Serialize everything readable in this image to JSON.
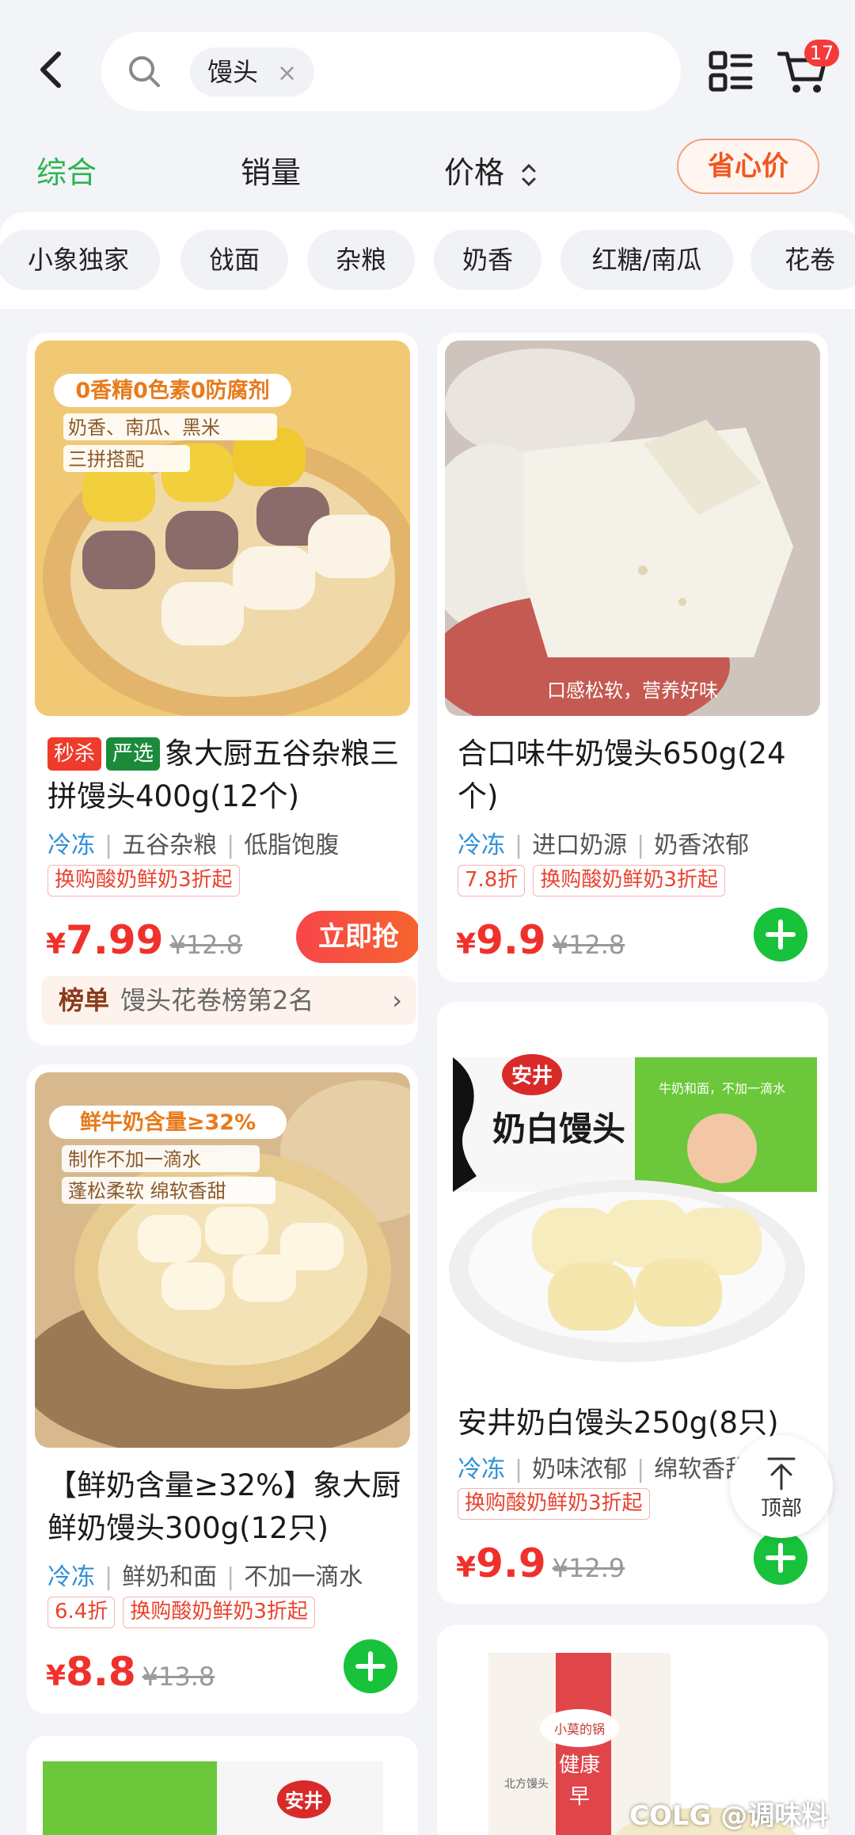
{
  "header": {
    "search_chip": "馒头",
    "search_chip_close": "×",
    "cart_count": "17"
  },
  "sort_tabs": [
    {
      "label": "综合",
      "active": true
    },
    {
      "label": "销量"
    },
    {
      "label": "价格"
    }
  ],
  "value_button": "省心价",
  "filters": [
    "小象独家",
    "戗面",
    "杂粮",
    "奶香",
    "红糖/南瓜",
    "花卷"
  ],
  "products": [
    {
      "badges": [
        "秒杀",
        "严选"
      ],
      "title": "象大厨五谷杂粮三拼馒头400g(12个)",
      "tags": [
        "冷冻",
        "五谷杂粮",
        "低脂饱腹"
      ],
      "promos": [
        "换购酸奶鲜奶3折起"
      ],
      "price_symbol": "¥",
      "price": "7.99",
      "old_price": "¥12.8",
      "buy_label": "立即抢",
      "rank_label": "榜单",
      "rank_text": "馒头花卷榜第2名",
      "image_texts": [
        "0香精0色素0防腐剂",
        "奶香、南瓜、黑米",
        "三拼搭配"
      ]
    },
    {
      "title": "合口味牛奶馒头650g(24个)",
      "tags": [
        "冷冻",
        "进口奶源",
        "奶香浓郁"
      ],
      "promos": [
        "7.8折",
        "换购酸奶鲜奶3折起"
      ],
      "price_symbol": "¥",
      "price": "9.9",
      "old_price": "¥12.8",
      "image_texts": [
        "口感松软，营养好味"
      ]
    },
    {
      "title": "【鲜奶含量≥32%】象大厨鲜奶馒头300g(12只)",
      "tags": [
        "冷冻",
        "鲜奶和面",
        "不加一滴水"
      ],
      "promos": [
        "6.4折",
        "换购酸奶鲜奶3折起"
      ],
      "price_symbol": "¥",
      "price": "8.8",
      "old_price": "¥13.8",
      "image_texts": [
        "鲜牛奶含量≥32%",
        "制作不加一滴水",
        "蓬松柔软 绵软香甜"
      ]
    },
    {
      "title": "安井奶白馒头250g(8只)",
      "tags": [
        "冷冻",
        "奶味浓郁",
        "绵软香甜"
      ],
      "promos": [
        "换购酸奶鲜奶3折起"
      ],
      "price_symbol": "¥",
      "price": "9.9",
      "old_price": "¥12.9",
      "image_texts": [
        "安井",
        "奶白馒头",
        "牛奶和面，不加一滴水"
      ]
    }
  ],
  "partial_card_texts": [
    "安井",
    "小莫的锅",
    "健康",
    "早",
    "北方馒头"
  ],
  "to_top": "顶部",
  "watermark": "COLG @调味料"
}
